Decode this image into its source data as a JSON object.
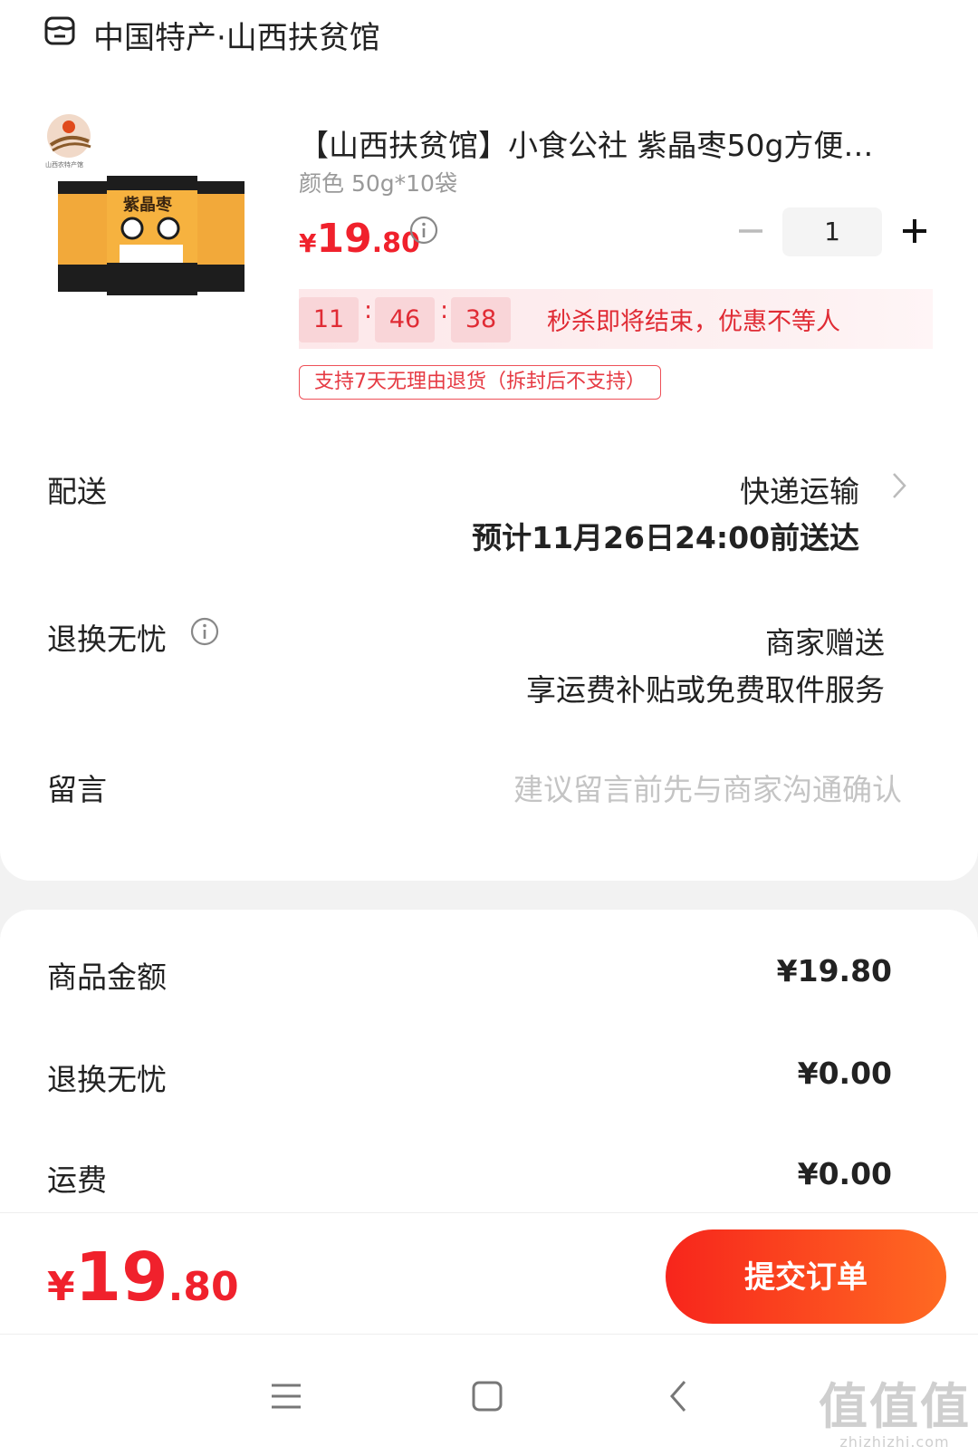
{
  "store": {
    "name": "中国特产·山西扶贫馆"
  },
  "product": {
    "title": "【山西扶贫馆】小食公社 紫晶枣50g方便…",
    "spec": "颜色 50g*10袋",
    "price_currency": "¥",
    "price_int": "19",
    "price_dec": ".80",
    "quantity": "1",
    "thumb_caption": "山西农特产馆"
  },
  "flash_sale": {
    "hours": "11",
    "minutes": "46",
    "seconds": "38",
    "sep": ":",
    "text": "秒杀即将结束，优惠不等人"
  },
  "return_tag": "支持7天无理由退货（拆封后不支持）",
  "delivery": {
    "label": "配送",
    "method": "快递运输",
    "eta": "预计11月26日24:00前送达"
  },
  "worry_free": {
    "label": "退换无忧",
    "value_line1": "商家赠送",
    "value_line2": "享运费补贴或免费取件服务"
  },
  "message": {
    "label": "留言",
    "placeholder": "建议留言前先与商家沟通确认"
  },
  "summary": [
    {
      "label": "商品金额",
      "value": "¥19.80"
    },
    {
      "label": "退换无忧",
      "value": "¥0.00"
    },
    {
      "label": "运费",
      "value": "¥0.00"
    }
  ],
  "footer": {
    "total_currency": "¥",
    "total_int": "19",
    "total_dec": ".80",
    "submit_label": "提交订单"
  },
  "watermark": {
    "big": "值值值",
    "small": "zhizhizhi.com"
  },
  "icons": {
    "store": "store-icon",
    "info": "info-circle-icon",
    "chevron": "chevron-right-icon",
    "minus": "minus-icon",
    "plus": "plus-icon",
    "nav_menu": "menu-icon",
    "nav_home": "home-square-icon",
    "nav_back": "back-arrow-icon"
  },
  "colors": {
    "accent": "#f0212c",
    "submit_start": "#f7251c",
    "submit_end": "#ff6a22"
  }
}
